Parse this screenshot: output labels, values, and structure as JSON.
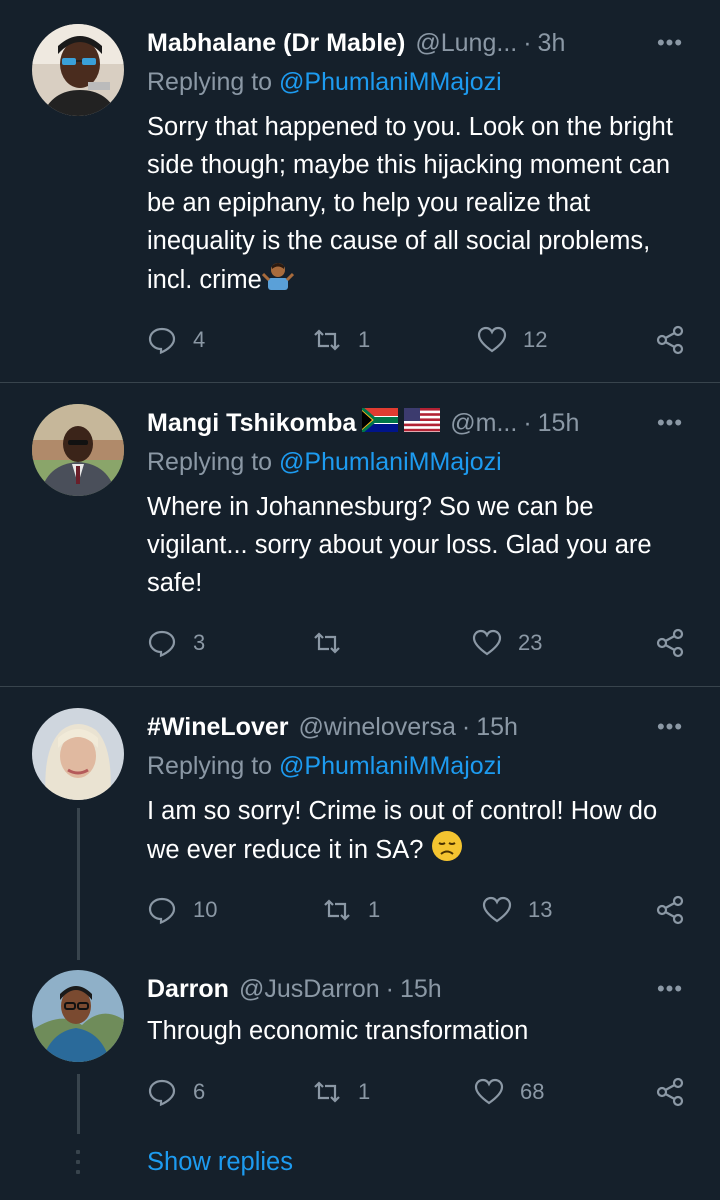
{
  "tweets": [
    {
      "name": "Mabhalane (Dr Mable)",
      "handle": "@Lung...",
      "time": "3h",
      "reply_prefix": "Replying to",
      "reply_mention": "@PhumlaniMMajozi",
      "text": "Sorry that happened to you. Look on the bright side though; maybe this hijacking moment can be an epiphany, to help you realize that inequality is the cause of all social problems, incl. crime",
      "emoji": "person-shrugging-emoji",
      "replies": "4",
      "retweets": "1",
      "likes": "12"
    },
    {
      "name": "Mangi Tshikomba",
      "flags": [
        "south-africa-flag",
        "usa-flag"
      ],
      "handle": "@m...",
      "time": "15h",
      "reply_prefix": "Replying to",
      "reply_mention": "@PhumlaniMMajozi",
      "text": "Where in Johannesburg? So we can be vigilant... sorry about your loss. Glad you are safe!",
      "replies": "3",
      "retweets": "",
      "likes": "23"
    },
    {
      "name": "#WineLover",
      "handle": "@wineloversa",
      "time": "15h",
      "reply_prefix": "Replying to",
      "reply_mention": "@PhumlaniMMajozi",
      "text": "I am so sorry! Crime is out of control! How do we ever reduce it in SA?",
      "emoji": "disappointed-face-emoji",
      "replies": "10",
      "retweets": "1",
      "likes": "13"
    },
    {
      "name": "Darron",
      "handle": "@JusDarron",
      "time": "15h",
      "text": "Through economic transformation",
      "replies": "6",
      "retweets": "1",
      "likes": "68"
    }
  ],
  "separator": "·",
  "more_glyph": "•••",
  "show_replies": "Show replies",
  "colors": {
    "background": "#15202b",
    "secondary_text": "#8b98a5",
    "accent": "#1d9bf0",
    "divider": "#38444d"
  }
}
